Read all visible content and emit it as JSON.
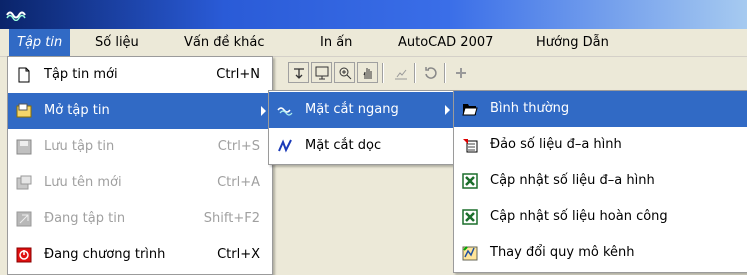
{
  "menubar": {
    "items": [
      {
        "label": "Tập tin"
      },
      {
        "label": "Số liệu"
      },
      {
        "label": "Vấn đề khác"
      },
      {
        "label": "In ấn"
      },
      {
        "label": "AutoCAD 2007"
      },
      {
        "label": "Hướng Dẫn"
      }
    ]
  },
  "file_menu": {
    "items": [
      {
        "label": "Tập tin mới",
        "shortcut": "Ctrl+N",
        "icon": "new-file-icon"
      },
      {
        "label": "Mở tập tin",
        "shortcut": "",
        "icon": "open-file-icon"
      },
      {
        "label": "Lưu tập tin",
        "shortcut": "Ctrl+S",
        "icon": "save-icon"
      },
      {
        "label": "Lưu tên mới",
        "shortcut": "Ctrl+A",
        "icon": "save-as-icon"
      },
      {
        "label": "Đang tập tin",
        "shortcut": "Shift+F2",
        "icon": "close-file-icon"
      },
      {
        "label": "Đang chương trình",
        "shortcut": "Ctrl+X",
        "icon": "exit-icon"
      }
    ]
  },
  "open_submenu": {
    "items": [
      {
        "label": "Mặt cắt ngang",
        "icon": "cross-section-icon"
      },
      {
        "label": "Mặt cắt dọc",
        "icon": "longitudinal-section-icon"
      }
    ]
  },
  "cross_section_submenu": {
    "items": [
      {
        "label": "Bình thường",
        "icon": "folder-open-icon"
      },
      {
        "label": "Đảo số liệu đ–a hình",
        "icon": "reverse-data-icon"
      },
      {
        "label": "Cập nhật số liệu đ–a hình",
        "icon": "excel-update-icon"
      },
      {
        "label": "Cập nhật số liệu hoàn công",
        "icon": "excel-update-icon"
      },
      {
        "label": "Thay đổi quy mô kênh",
        "icon": "change-scale-icon"
      }
    ]
  },
  "colors": {
    "highlight": "#316ac5",
    "menubar_bg": "#ece9d8",
    "disabled_text": "#a0a0a0"
  }
}
